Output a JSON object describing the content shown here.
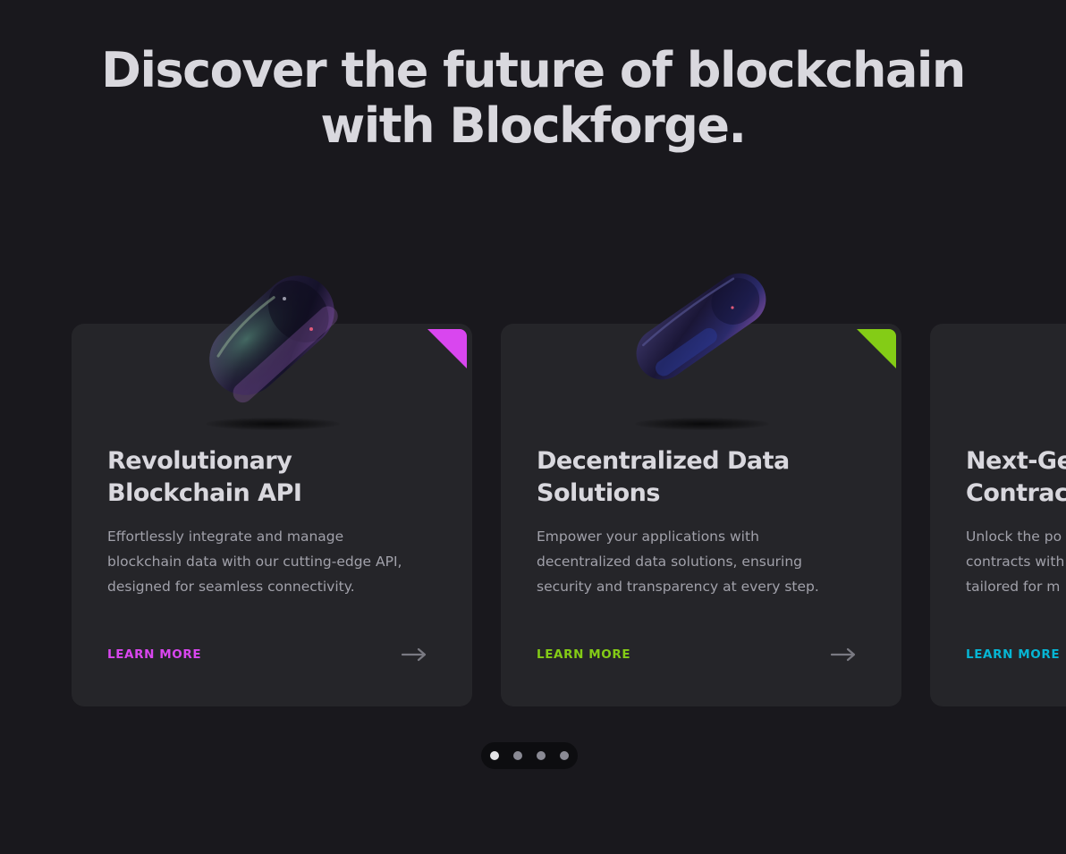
{
  "hero": {
    "title_line1": "Discover the future of blockchain",
    "title_line2": "with Blockforge."
  },
  "cards": [
    {
      "title_line1": "Revolutionary",
      "title_line2": "Blockchain API",
      "desc_line1": "Effortlessly integrate and manage",
      "desc_line2": "blockchain data with our cutting-edge API,",
      "desc_line3": "designed for seamless connectivity.",
      "cta": "LEARN MORE",
      "accent": "#d946ef",
      "icon": "pill-3d-image"
    },
    {
      "title_line1": "Decentralized Data",
      "title_line2": "Solutions",
      "desc_line1": "Empower your applications with",
      "desc_line2": "decentralized data solutions, ensuring",
      "desc_line3": "security and transparency at every step.",
      "cta": "LEARN MORE",
      "accent": "#84cc16",
      "icon": "pill-3d-image"
    },
    {
      "title_line1": "Next-Ge",
      "title_line2": "Contrac",
      "desc_line1": "Unlock the po",
      "desc_line2": "contracts with",
      "desc_line3": "tailored for m",
      "cta": "LEARN MORE",
      "accent": "#06b6d4"
    }
  ],
  "pagination": {
    "total": 4,
    "active": 1
  },
  "colors": {
    "background": "#19181d",
    "card": "#252529",
    "heading": "#d9d8de",
    "body_text": "#a1a1aa"
  }
}
